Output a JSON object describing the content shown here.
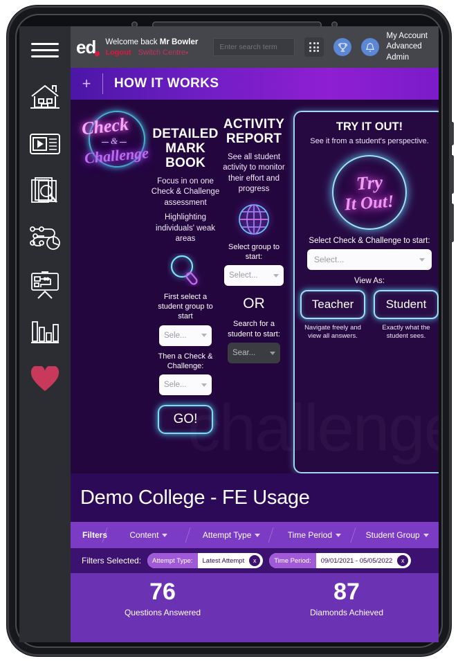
{
  "sidebar": {
    "items": [
      {
        "name": "menu",
        "icon": "hamburger-icon"
      },
      {
        "name": "home",
        "icon": "house-icon"
      },
      {
        "name": "media",
        "icon": "video-playlist-icon"
      },
      {
        "name": "resources",
        "icon": "document-search-icon"
      },
      {
        "name": "pathways",
        "icon": "pathway-pie-icon"
      },
      {
        "name": "whiteboard",
        "icon": "presentation-board-icon"
      },
      {
        "name": "reports",
        "icon": "bar-chart-icon"
      },
      {
        "name": "favourites",
        "icon": "heart-icon"
      }
    ],
    "heart_color": "#c8395c"
  },
  "topbar": {
    "logo": "ed",
    "welcome_prefix": "Welcome back ",
    "welcome_name": "Mr Bowler",
    "logout": "Logout",
    "switch_centre": "Switch Centre",
    "switch_caret": "▾",
    "search_placeholder": "Enter search term",
    "search_value": "",
    "grid_icon": "apps-grid-icon",
    "trophy_icon": "trophy-icon",
    "bell_icon": "bell-icon",
    "account_line1": "My Account",
    "account_line2": "Advanced",
    "account_line3": "Admin"
  },
  "how_it_works": {
    "plus": "+",
    "title": "HOW IT WORKS"
  },
  "hero": {
    "watermark": "challenge",
    "logo": {
      "check": "Check",
      "amp": "&",
      "challenge": "Challenge"
    },
    "markbook": {
      "heading": "DETAILED MARK BOOK",
      "body1": "Focus in on one Check & Challenge assessment",
      "body2": "Highlighting individuals' weak areas",
      "icon": "magnifier-icon",
      "label1": "First select a student group to start",
      "select1": "Sele...",
      "label2": "Then a Check & Challenge:",
      "select2": "Sele...",
      "go": "GO!"
    },
    "activity": {
      "heading": "ACTIVITY REPORT",
      "body": "See all student activity to monitor their effort and progress",
      "icon": "globe-icon",
      "label1": "Select group to start:",
      "select1": "Select...",
      "or": "OR",
      "label2": "Search for a student to start:",
      "search": "Sear..."
    },
    "tryout": {
      "heading": "TRY IT OUT!",
      "subheading": "See it from a student's perspective.",
      "circle_line1": "Try",
      "circle_line2": "It Out!",
      "select_label": "Select Check & Challenge to start:",
      "select_value": "Select...",
      "view_as": "View As:",
      "roles": [
        {
          "label": "Teacher",
          "caption": "Navigate freely and view all answers."
        },
        {
          "label": "Student",
          "caption": "Exactly what the student sees."
        }
      ]
    }
  },
  "dashboard": {
    "title": "Demo College - FE Usage",
    "filters": {
      "label": "Filters",
      "items": [
        "Content",
        "Attempt Type",
        "Time Period",
        "Student Group"
      ]
    },
    "selected": {
      "label": "Filters Selected:",
      "chips": [
        {
          "key": "Attempt Type:",
          "value": "Latest Attempt",
          "remove": "x"
        },
        {
          "key": "Time Period:",
          "value": "09/01/2021 - 05/05/2022",
          "remove": "x"
        }
      ]
    },
    "kpis": [
      {
        "value": "76",
        "label": "Questions Answered"
      },
      {
        "value": "87",
        "label": "Diamonds Achieved"
      }
    ]
  }
}
